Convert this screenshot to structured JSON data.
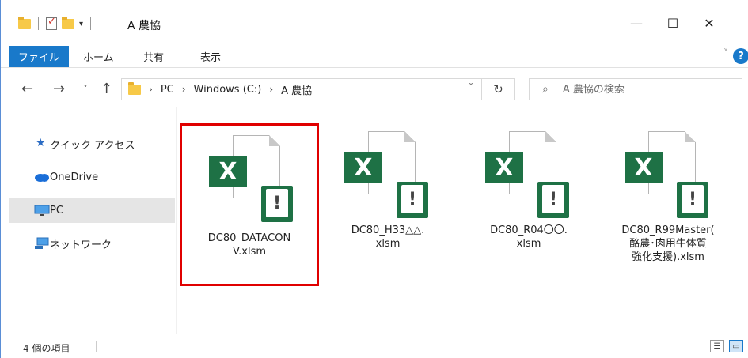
{
  "window": {
    "title": "A 農協",
    "controls": {
      "minimize": "—",
      "maximize": "☐",
      "close": "✕"
    }
  },
  "ribbon": {
    "file_tab": "ファイル",
    "tabs": [
      "ホーム",
      "共有",
      "表示"
    ],
    "help": "?"
  },
  "nav": {
    "back": "←",
    "forward": "→",
    "recent": "˅",
    "up": "↑",
    "breadcrumb": [
      "PC",
      "Windows (C:)",
      "A 農協"
    ],
    "refresh": "↻"
  },
  "search": {
    "placeholder": "A 農協の検索"
  },
  "navpane": {
    "items": [
      {
        "label": "クイック アクセス",
        "icon": "star-icon"
      },
      {
        "label": "OneDrive",
        "icon": "cloud-icon"
      },
      {
        "label": "PC",
        "icon": "monitor-icon",
        "selected": true
      },
      {
        "label": "ネットワーク",
        "icon": "network-icon"
      }
    ]
  },
  "files": [
    {
      "name": "DC80_DATACON\nV.xlsm",
      "icon": "excel-macro-file-icon",
      "highlighted": true
    },
    {
      "name": "DC80_H33△△.\nxlsm",
      "icon": "excel-macro-file-icon"
    },
    {
      "name": "DC80_R04〇〇.\nxlsm",
      "icon": "excel-macro-file-icon"
    },
    {
      "name": "DC80_R99Master(\n酪農･肉用牛体質\n強化支援).xlsm",
      "icon": "excel-macro-file-icon"
    }
  ],
  "status": {
    "item_count": "4 個の項目"
  },
  "colors": {
    "accent": "#1979ca",
    "excel_green": "#1e7145",
    "highlight_red": "#e00000"
  }
}
